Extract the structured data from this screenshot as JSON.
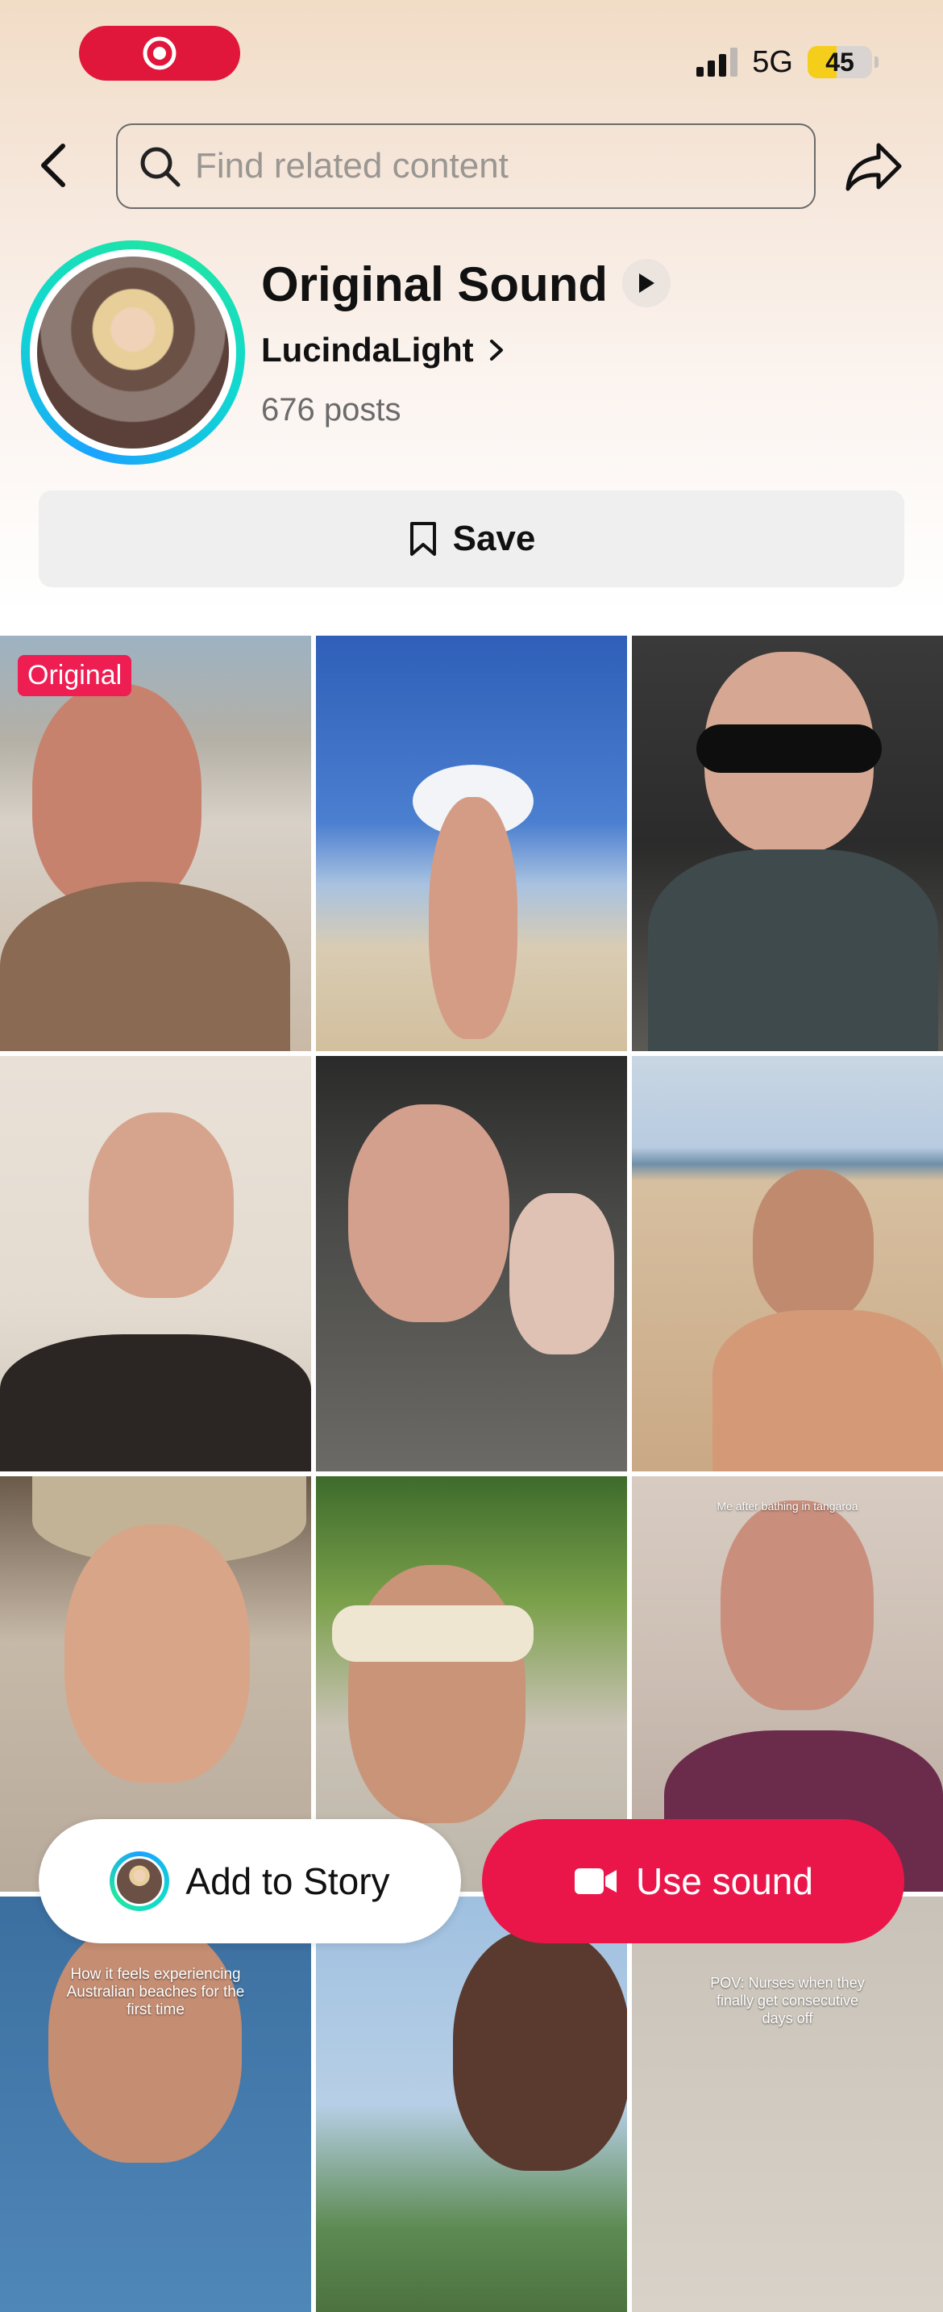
{
  "status_bar": {
    "recording_icon": "record-dot-icon",
    "network": "5G",
    "battery_percent": "45",
    "battery_level": 0.45,
    "signal_bars_active": 3,
    "accent": "#e0173a",
    "battery_color": "#f5cd1b"
  },
  "header": {
    "back_icon": "chevron-left-icon",
    "search_placeholder": "Find related content",
    "search_value": "",
    "share_icon": "share-arrow-icon"
  },
  "sound": {
    "title": "Original Sound",
    "author": "LucindaLight",
    "posts": "676 posts",
    "play_icon": "play-icon",
    "author_chevron_icon": "chevron-right-icon"
  },
  "actions": {
    "save_label": "Save",
    "save_icon": "bookmark-icon",
    "add_to_story_label": "Add to Story",
    "use_sound_label": "Use sound",
    "use_sound_icon": "video-camera-icon",
    "brand_color": "#ea164a"
  },
  "videos": [
    {
      "badge": "Original",
      "caption": ""
    },
    {
      "badge": "",
      "caption": ""
    },
    {
      "badge": "",
      "caption": ""
    },
    {
      "badge": "",
      "caption": ""
    },
    {
      "badge": "",
      "caption": ""
    },
    {
      "badge": "",
      "caption": ""
    },
    {
      "badge": "",
      "caption": ""
    },
    {
      "badge": "",
      "caption": ""
    },
    {
      "badge": "",
      "caption": "Me after bathing in tangaroa"
    },
    {
      "badge": "",
      "caption": "How it feels experiencing Australian beaches for the first time"
    },
    {
      "badge": "",
      "caption": ""
    },
    {
      "badge": "",
      "caption": "POV: Nurses when they finally get consecutive days off"
    }
  ]
}
